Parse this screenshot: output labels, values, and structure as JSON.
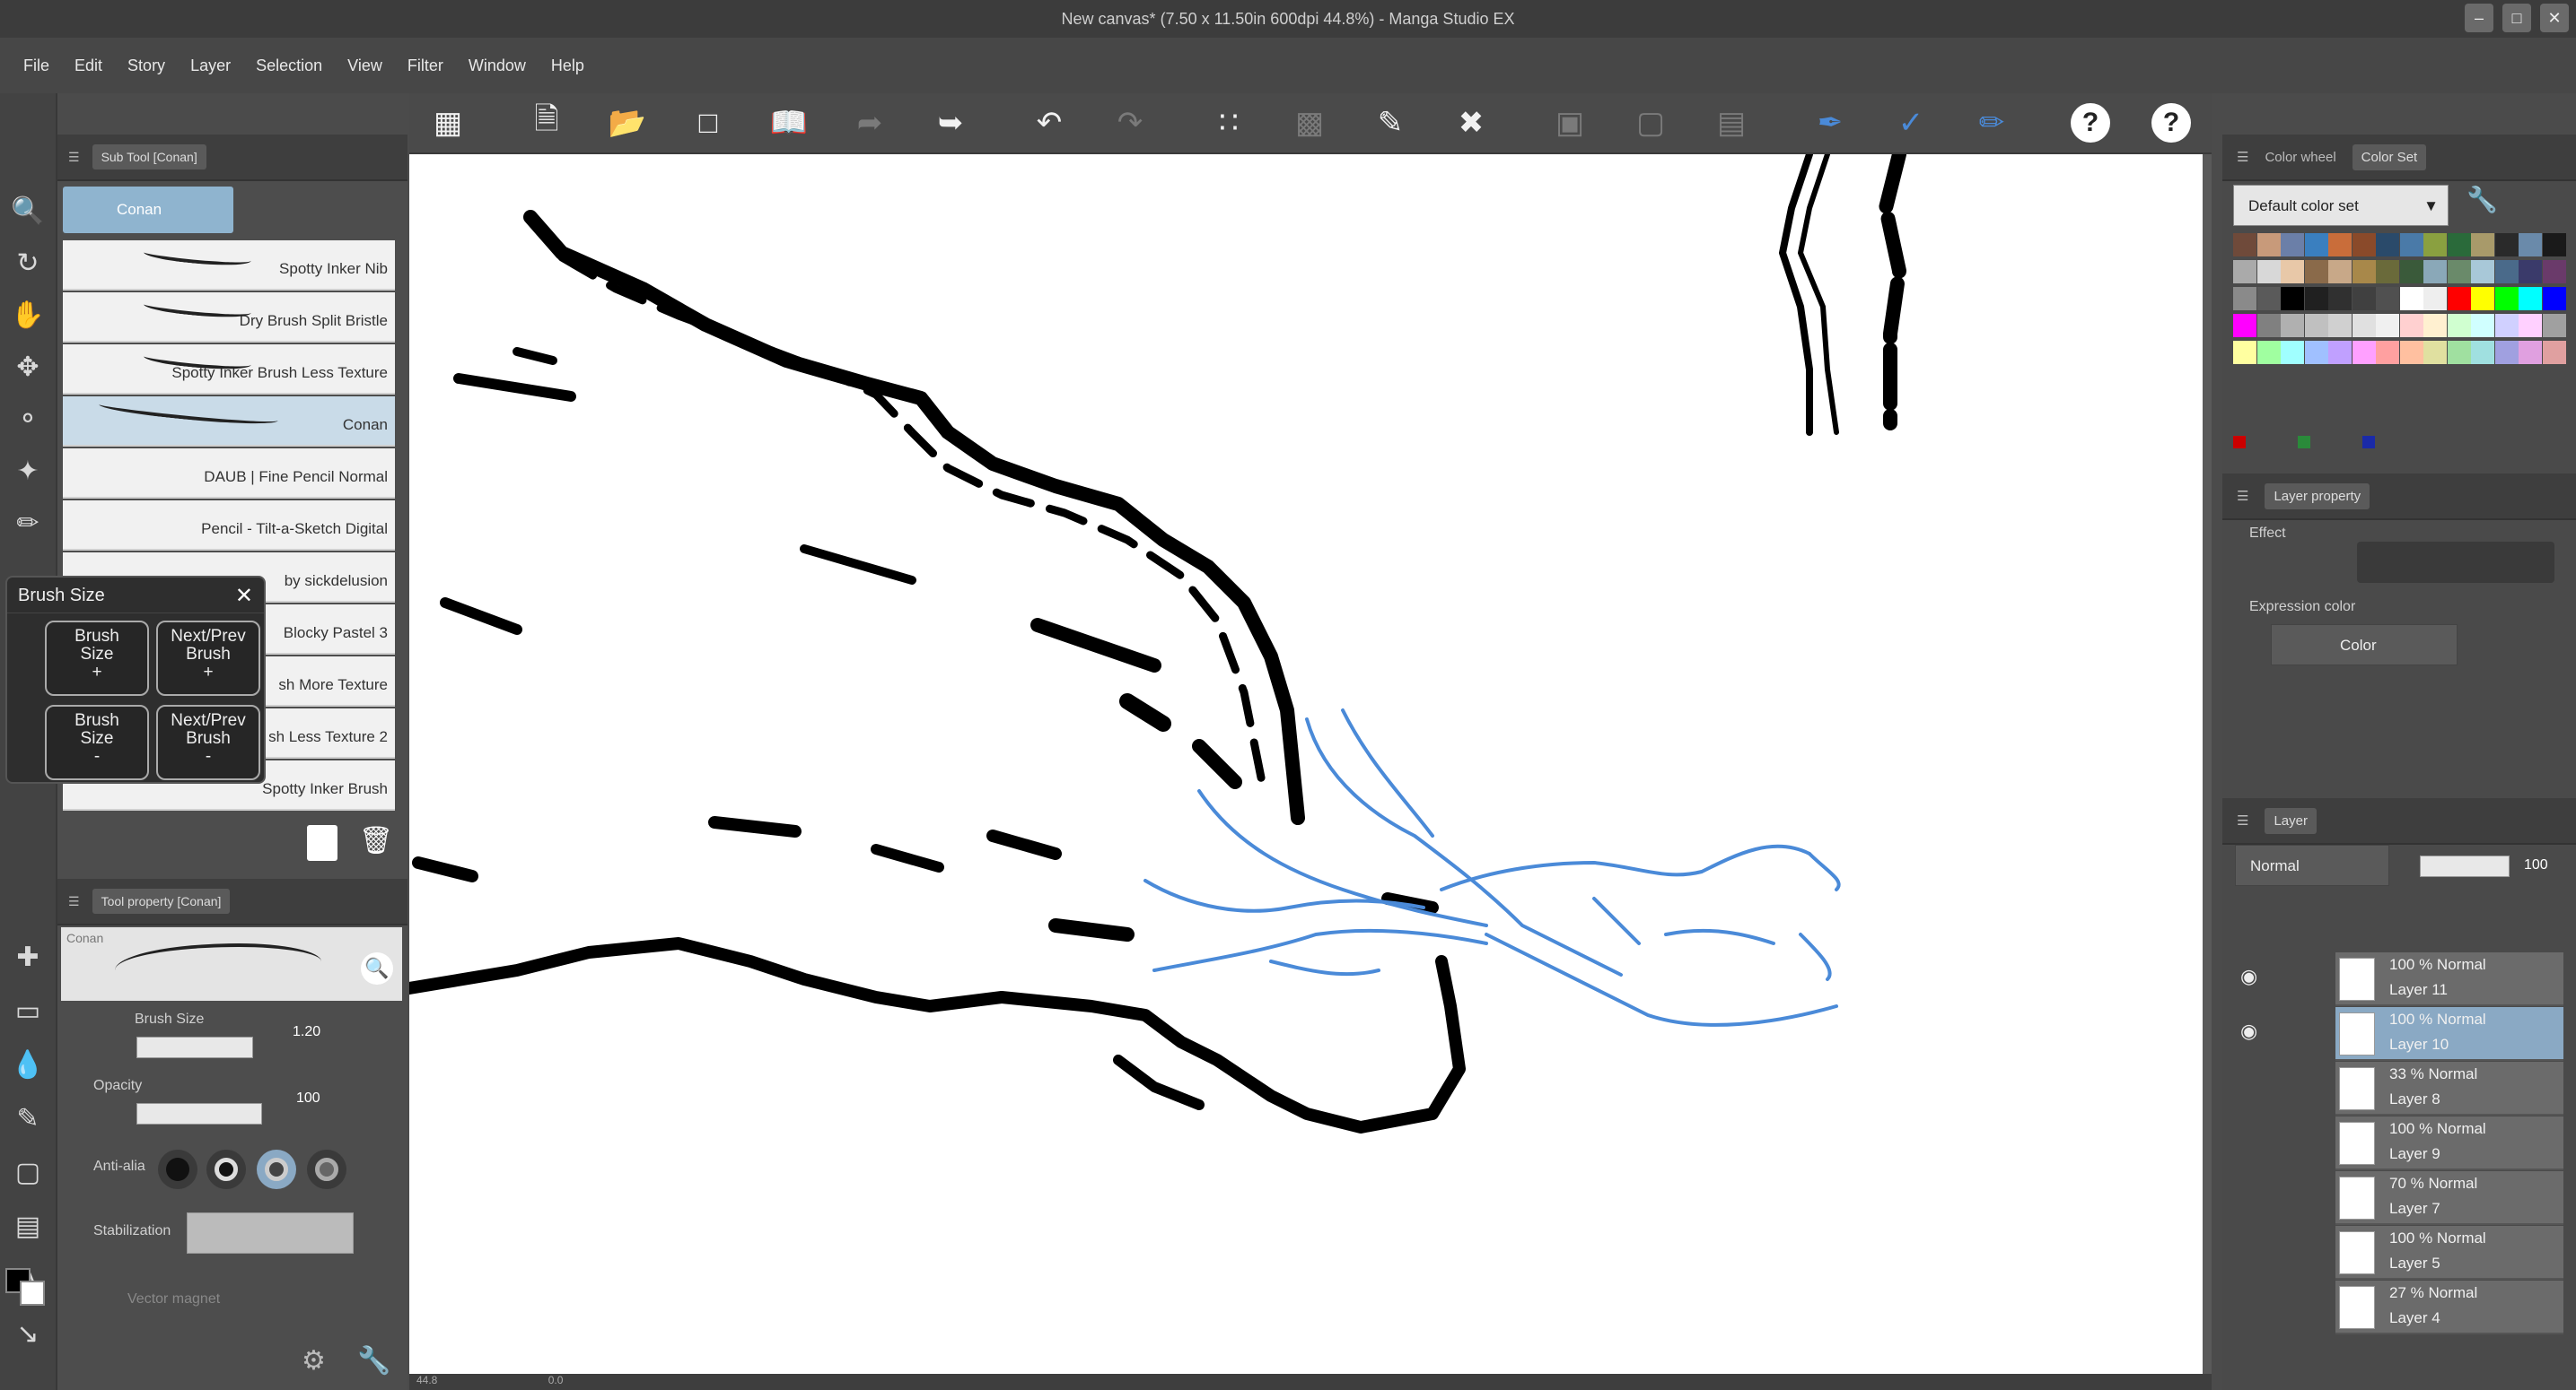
{
  "window": {
    "title": "New canvas* (7.50 x 11.50in 600dpi 44.8%) - Manga Studio EX",
    "minimize": "–",
    "maximize": "□",
    "close": "✕"
  },
  "menu": [
    "File",
    "Edit",
    "Story",
    "Layer",
    "Selection",
    "View",
    "Filter",
    "Window",
    "Help"
  ],
  "toolbar": {
    "icons": [
      "grid-icon",
      "new-file-icon",
      "open-folder-icon",
      "save-icon",
      "book-icon",
      "redo-arrow-icon",
      "export-icon",
      "undo-icon",
      "redo-icon",
      "transform-dots-icon",
      "selection-box-icon",
      "eraser-icon",
      "transform-icon",
      "dim-icon-1",
      "dim-icon-2",
      "grid-select-icon",
      "pen-ruler-icon",
      "ruler-icon",
      "pen-blue-icon",
      "help-icon",
      "help-icon-2"
    ],
    "help_label": "?"
  },
  "subtool": {
    "tab_label": "Sub Tool [Conan]",
    "group_label": "Conan",
    "brushes": [
      "Spotty Inker Nib",
      "Dry Brush Split Bristle",
      "Spotty Inker Brush Less Texture",
      "Conan",
      "DAUB | Fine Pencil Normal",
      "Pencil - Tilt-a-Sketch Digital",
      "by sickdelusion",
      "Blocky Pastel 3",
      "sh More Texture",
      "sh Less Texture 2",
      "Spotty Inker Brush"
    ],
    "selected_index": 3
  },
  "brushsize_popup": {
    "title": "Brush Size",
    "close": "✕",
    "buttons": [
      {
        "line1": "Brush",
        "line2": "Size",
        "sign": "+"
      },
      {
        "line1": "Next/Prev",
        "line2": "Brush",
        "sign": "+"
      },
      {
        "line1": "Brush",
        "line2": "Size",
        "sign": "-"
      },
      {
        "line1": "Next/Prev",
        "line2": "Brush",
        "sign": "-"
      }
    ]
  },
  "toolprop": {
    "tab_label": "Tool property [Conan]",
    "preview_label": "Conan",
    "brush_size_label": "Brush Size",
    "brush_size_value": "1.20",
    "opacity_label": "Opacity",
    "opacity_value": "100",
    "antialias_label": "Anti-alia",
    "stabilization_label": "Stabilization",
    "vector_label": "Vector magnet"
  },
  "color": {
    "tab1": "Color wheel",
    "tab2": "Color Set",
    "set_name": "Default color set",
    "swatches": [
      "#6f4a3a",
      "#c89a7a",
      "#6b7fa8",
      "#3a7fbf",
      "#c96d3a",
      "#8a4a2a",
      "#2a4a6a",
      "#4a7aa8",
      "#8aa040",
      "#2a6a3a",
      "#a89a6a",
      "#2a2a2a",
      "#6a8aaa",
      "#1a1a1a",
      "#aaaaaa",
      "#d8d8d8",
      "#e8c8a8",
      "#8a6a4a",
      "#c8a888",
      "#a8884a",
      "#6a6a3a",
      "#3a5a3a",
      "#8aa8b8",
      "#6a8a6a",
      "#a8c8d8",
      "#4a6a8a",
      "#3a3a6a",
      "#6a3a6a",
      "#8a8a8a",
      "#5a5a5a",
      "#000000",
      "#202020",
      "#303030",
      "#404040",
      "#505050",
      "#ffffff",
      "#eeeeee",
      "#ff0000",
      "#ffff00",
      "#00ff00",
      "#00ffff",
      "#0000ff",
      "#ff00ff",
      "#808080",
      "#b0b0b0",
      "#c0c0c0",
      "#d0d0d0",
      "#e0e0e0",
      "#f0f0f0",
      "#ffd0d0",
      "#fff0d0",
      "#d0ffd0",
      "#d0ffff",
      "#d0d0ff",
      "#ffd0ff",
      "#a0a0a0",
      "#ffffa0",
      "#a0ffa0",
      "#a0ffff",
      "#a0c0ff",
      "#c0a0ff",
      "#ffa0ff",
      "#ffa0a0",
      "#ffc0a0",
      "#e0e0a0",
      "#a0e0a0",
      "#a0e0e0",
      "#a0a0e0",
      "#e0a0e0",
      "#e0a0a0"
    ]
  },
  "layerprop": {
    "tab1": "Layer property",
    "effect_label": "Effect",
    "expression_label": "Expression color",
    "expression_value": "Color"
  },
  "layers": {
    "blend_mode": "Normal",
    "opacity": "100",
    "items": [
      {
        "pct": "100 %",
        "mode": "Normal",
        "name": "Layer 11"
      },
      {
        "pct": "100 %",
        "mode": "Normal",
        "name": "Layer 10"
      },
      {
        "pct": "33 %",
        "mode": "Normal",
        "name": "Layer 8"
      },
      {
        "pct": "100 %",
        "mode": "Normal",
        "name": "Layer 9"
      },
      {
        "pct": "70 %",
        "mode": "Normal",
        "name": "Layer 7"
      },
      {
        "pct": "100 %",
        "mode": "Normal",
        "name": "Layer 5"
      },
      {
        "pct": "27 %",
        "mode": "Normal",
        "name": "Layer 4"
      }
    ],
    "selected_index": 1,
    "tab_label": "Layer"
  },
  "status": {
    "zoom": "44.8",
    "pos": "0.0"
  },
  "colors": {
    "accent": "#8fb4cf",
    "stroke_blue": "#4a8ad8"
  }
}
